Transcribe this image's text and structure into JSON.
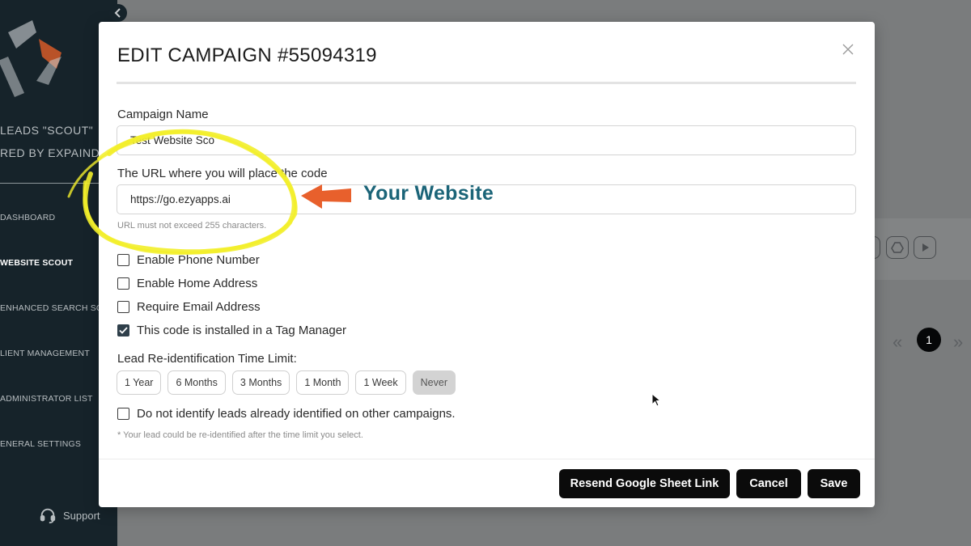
{
  "sidebar": {
    "brand_line1": "LEADS \"SCOUT\"",
    "brand_line2": "RED BY EXPAIND",
    "nav": [
      {
        "label": "DASHBOARD"
      },
      {
        "label": "WEBSITE SCOUT"
      },
      {
        "label": "ENHANCED SEARCH SCO"
      },
      {
        "label": "LIENT MANAGEMENT"
      },
      {
        "label": "ADMINISTRATOR LIST"
      },
      {
        "label": "ENERAL SETTINGS"
      }
    ],
    "support_label": "Support"
  },
  "background": {
    "pager_current": "1",
    "pager_prev": "«",
    "pager_next": "»"
  },
  "modal": {
    "title": "EDIT CAMPAIGN #55094319",
    "campaign_name_label": "Campaign Name",
    "campaign_name_value": "Test Website Sco",
    "url_label": "The URL where you will place the code",
    "url_value": "https://go.ezyapps.ai",
    "url_helper": "URL must not exceed 255 characters.",
    "checks": [
      {
        "label": "Enable Phone Number",
        "checked": false
      },
      {
        "label": "Enable Home Address",
        "checked": false
      },
      {
        "label": "Require Email Address",
        "checked": false
      },
      {
        "label": "This code is installed in a Tag Manager",
        "checked": true
      }
    ],
    "time_limit_label": "Lead Re-identification Time Limit:",
    "time_options": [
      {
        "label": "1 Year",
        "selected": false
      },
      {
        "label": "6 Months",
        "selected": false
      },
      {
        "label": "3 Months",
        "selected": false
      },
      {
        "label": "1 Month",
        "selected": false
      },
      {
        "label": "1 Week",
        "selected": false
      },
      {
        "label": "Never",
        "selected": true
      }
    ],
    "no_identify_label": "Do not identify leads already identified on other campaigns.",
    "no_identify_checked": false,
    "footnote": "* Your lead could be re-identified after the time limit you select.",
    "buttons": {
      "resend": "Resend Google Sheet Link",
      "cancel": "Cancel",
      "save": "Save"
    }
  },
  "annotation": {
    "text": "Your Website",
    "arrow_color": "#e8602c",
    "circle_color": "#f2ee2a",
    "text_color": "#1b6478"
  }
}
